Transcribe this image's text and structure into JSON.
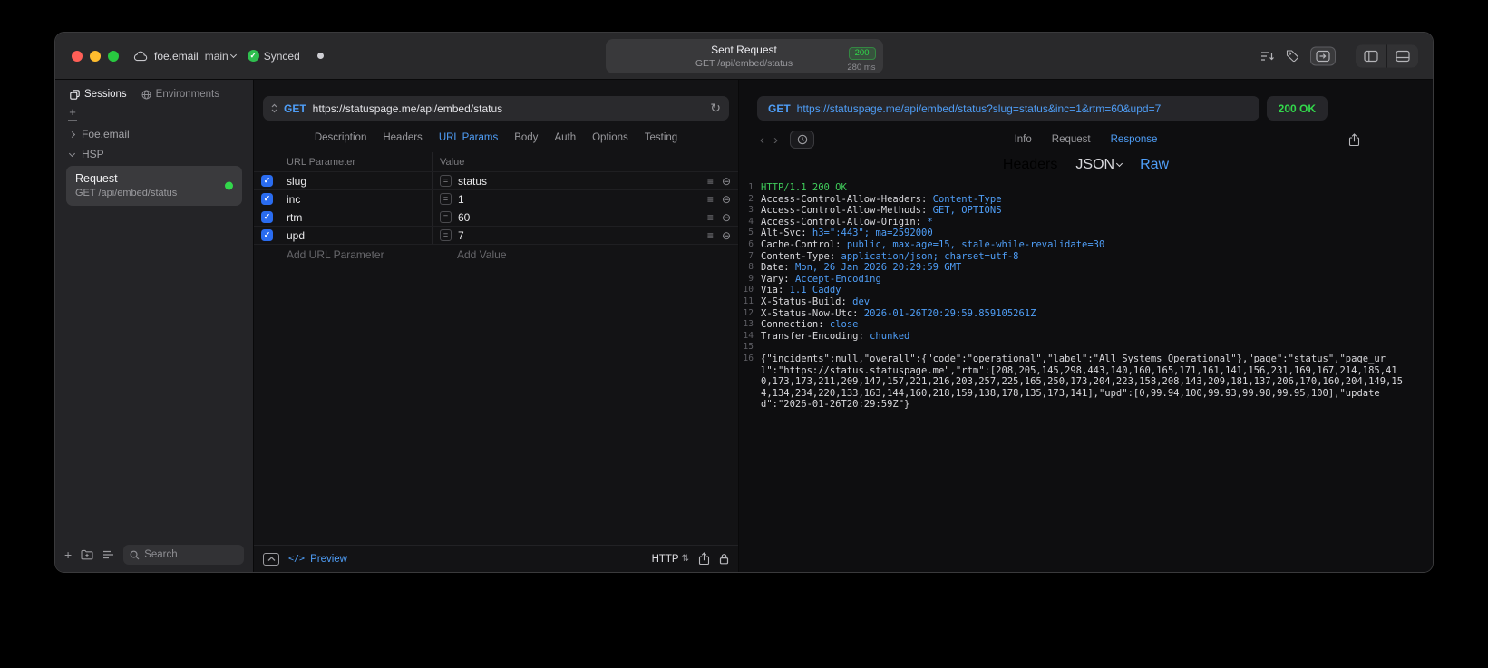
{
  "titlebar": {
    "account": "foe.email",
    "branch": "main",
    "sync_status": "Synced",
    "request_summary": {
      "title": "Sent Request",
      "status_code": "200",
      "method_path": "GET /api/embed/status",
      "duration": "280 ms"
    }
  },
  "sidebar": {
    "tabs": [
      {
        "label": "Sessions"
      },
      {
        "label": "Environments"
      }
    ],
    "active_tab": "Sessions",
    "tree": [
      {
        "label": "Foe.email",
        "expanded": false
      },
      {
        "label": "HSP",
        "expanded": true
      }
    ],
    "request_item": {
      "title": "Request",
      "subtitle": "GET /api/embed/status"
    },
    "search_placeholder": "Search"
  },
  "request_pane": {
    "method": "GET",
    "url": "https://statuspage.me/api/embed/status",
    "tabs": [
      "Description",
      "Headers",
      "URL Params",
      "Body",
      "Auth",
      "Options",
      "Testing"
    ],
    "active_tab": "URL Params",
    "params_table": {
      "columns": [
        "URL Parameter",
        "Value"
      ],
      "rows": [
        {
          "enabled": true,
          "name": "slug",
          "value": "status"
        },
        {
          "enabled": true,
          "name": "inc",
          "value": "1"
        },
        {
          "enabled": true,
          "name": "rtm",
          "value": "60"
        },
        {
          "enabled": true,
          "name": "upd",
          "value": "7"
        }
      ],
      "add_parameter_label": "Add URL Parameter",
      "add_value_label": "Add Value"
    },
    "footer": {
      "code_glyph": "</>",
      "preview_label": "Preview",
      "protocol_label": "HTTP"
    }
  },
  "response_pane": {
    "request_line": {
      "method": "GET",
      "url": "https://statuspage.me/api/embed/status?slug=status&inc=1&rtm=60&upd=7"
    },
    "status": "200 OK",
    "tabs": [
      {
        "label": "Info"
      },
      {
        "label": "Request"
      },
      {
        "label": "Response",
        "active": true
      }
    ],
    "subtabs": [
      {
        "label": "Headers"
      },
      {
        "label": "JSON",
        "dropdown": true
      },
      {
        "label": "Raw",
        "active": true
      }
    ],
    "code_lines": [
      [
        {
          "t": "HTTP/1.1 200 OK",
          "c": "g"
        }
      ],
      [
        {
          "t": "Access-Control-Allow-Headers: ",
          "c": "w"
        },
        {
          "t": "Content-Type",
          "c": "b"
        }
      ],
      [
        {
          "t": "Access-Control-Allow-Methods: ",
          "c": "w"
        },
        {
          "t": "GET, OPTIONS",
          "c": "b"
        }
      ],
      [
        {
          "t": "Access-Control-Allow-Origin: ",
          "c": "w"
        },
        {
          "t": "*",
          "c": "b"
        }
      ],
      [
        {
          "t": "Alt-Svc: ",
          "c": "w"
        },
        {
          "t": "h3=\":443\"; ma=2592000",
          "c": "b"
        }
      ],
      [
        {
          "t": "Cache-Control: ",
          "c": "w"
        },
        {
          "t": "public, max-age=15, stale-while-revalidate=30",
          "c": "b"
        }
      ],
      [
        {
          "t": "Content-Type: ",
          "c": "w"
        },
        {
          "t": "application/json; charset=utf-8",
          "c": "b"
        }
      ],
      [
        {
          "t": "Date: ",
          "c": "w"
        },
        {
          "t": "Mon, 26 Jan 2026 20:29:59 GMT",
          "c": "b"
        }
      ],
      [
        {
          "t": "Vary: ",
          "c": "w"
        },
        {
          "t": "Accept-Encoding",
          "c": "b"
        }
      ],
      [
        {
          "t": "Via: ",
          "c": "w"
        },
        {
          "t": "1.1 Caddy",
          "c": "b"
        }
      ],
      [
        {
          "t": "X-Status-Build: ",
          "c": "w"
        },
        {
          "t": "dev",
          "c": "b"
        }
      ],
      [
        {
          "t": "X-Status-Now-Utc: ",
          "c": "w"
        },
        {
          "t": "2026-01-26T20:29:59.859105261Z",
          "c": "b"
        }
      ],
      [
        {
          "t": "Connection: ",
          "c": "w"
        },
        {
          "t": "close",
          "c": "b"
        }
      ],
      [
        {
          "t": "Transfer-Encoding: ",
          "c": "w"
        },
        {
          "t": "chunked",
          "c": "b"
        }
      ],
      [],
      [
        {
          "t": "{\"incidents\":null,\"overall\":{\"code\":\"operational\",\"label\":\"All Systems Operational\"},\"page\":\"status\",\"page_url\":\"https://status.statuspage.me\",\"rtm\":[208,205,145,298,443,140,160,165,171,161,141,156,231,169,167,214,185,410,173,173,211,209,147,157,221,216,203,257,225,165,250,173,204,223,158,208,143,209,181,137,206,170,160,204,149,154,134,234,220,133,163,144,160,218,159,138,178,135,173,141],\"upd\":[0,99.94,100,99.93,99.98,99.95,100],\"updated\":\"2026-01-26T20:29:59Z\"}",
          "c": "w"
        }
      ]
    ]
  },
  "icons": {
    "check": "✓",
    "refresh": "↻",
    "hamburger": "≡",
    "remove": "⊖",
    "back": "‹",
    "forward": "›",
    "updown": "⇅"
  },
  "colors": {
    "accent_blue": "#4f9ef7",
    "success_green": "#32d74b",
    "status_line_green": "#3fca5a",
    "traffic_red": "#ff5f57",
    "traffic_yellow": "#febc2e",
    "traffic_green": "#28c840"
  }
}
